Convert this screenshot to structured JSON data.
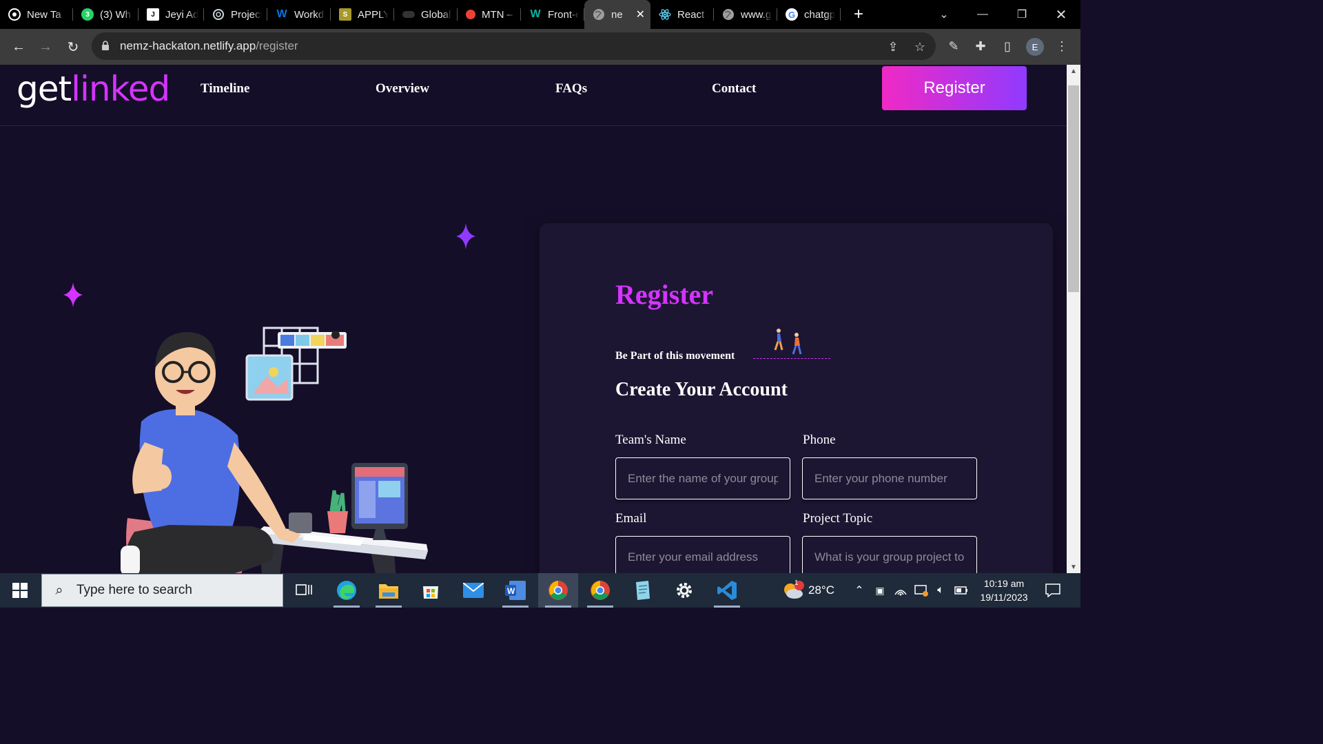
{
  "browser": {
    "tabs": [
      {
        "label": "New Ta",
        "icon": "chrome-icon",
        "color": "#ffffff"
      },
      {
        "label": "(3) Wh",
        "icon": "whatsapp-icon",
        "color": "#25d366",
        "badge": "3"
      },
      {
        "label": "Jeyi Ad",
        "icon": "jeyi-icon",
        "color": "#ffffff"
      },
      {
        "label": "Project",
        "icon": "chatgpt-icon",
        "color": "#cfd8dc"
      },
      {
        "label": "Workd",
        "icon": "workday-icon",
        "color": "#0875e1"
      },
      {
        "label": "APPLY:",
        "icon": "apply-icon",
        "color": "#a89a2a"
      },
      {
        "label": "Global",
        "icon": "global-icon",
        "color": "#444444"
      },
      {
        "label": "MTN –",
        "icon": "record-icon",
        "color": "#ea4335"
      },
      {
        "label": "Front-e",
        "icon": "frontend-icon",
        "color": "#0bb5a5"
      },
      {
        "label": "ne",
        "icon": "globe-icon",
        "color": "#bbbbbb",
        "active": true
      },
      {
        "label": "React /",
        "icon": "react-icon",
        "color": "#61dafb"
      },
      {
        "label": "www.g",
        "icon": "globe-icon",
        "color": "#bbbbbb"
      },
      {
        "label": "chatgp",
        "icon": "google-icon",
        "color": "#4285f4"
      }
    ],
    "url_host": "nemz-hackaton.netlify.app",
    "url_path": "/register",
    "profile_initial": "E"
  },
  "site": {
    "logo_main": "get",
    "logo_highlight": "linked",
    "nav": [
      "Timeline",
      "Overview",
      "FAQs",
      "Contact"
    ],
    "register_button": "Register",
    "colors": {
      "accent": "#d434fe",
      "gradient_start": "#f129c5",
      "gradient_end": "#903aff",
      "background": "#150e28"
    }
  },
  "form": {
    "title": "Register",
    "tagline": "Be Part of this movement",
    "heading": "Create Your Account",
    "fields": [
      {
        "label": "Team's Name",
        "placeholder": "Enter the name of your group"
      },
      {
        "label": "Phone",
        "placeholder": "Enter your phone number"
      },
      {
        "label": "Email",
        "placeholder": "Enter your email address"
      },
      {
        "label": "Project Topic",
        "placeholder": "What is your group project topic"
      }
    ]
  },
  "taskbar": {
    "search_placeholder": "Type here to search",
    "apps": [
      "task-view-icon",
      "edge-icon",
      "file-explorer-icon",
      "microsoft-store-icon",
      "mail-icon",
      "word-icon",
      "chrome-icon",
      "chrome-icon",
      "notepad-icon",
      "settings-icon",
      "vscode-icon"
    ],
    "weather_temp": "28°C",
    "weather_badge": "1",
    "time": "10:19 am",
    "date": "19/11/2023"
  }
}
